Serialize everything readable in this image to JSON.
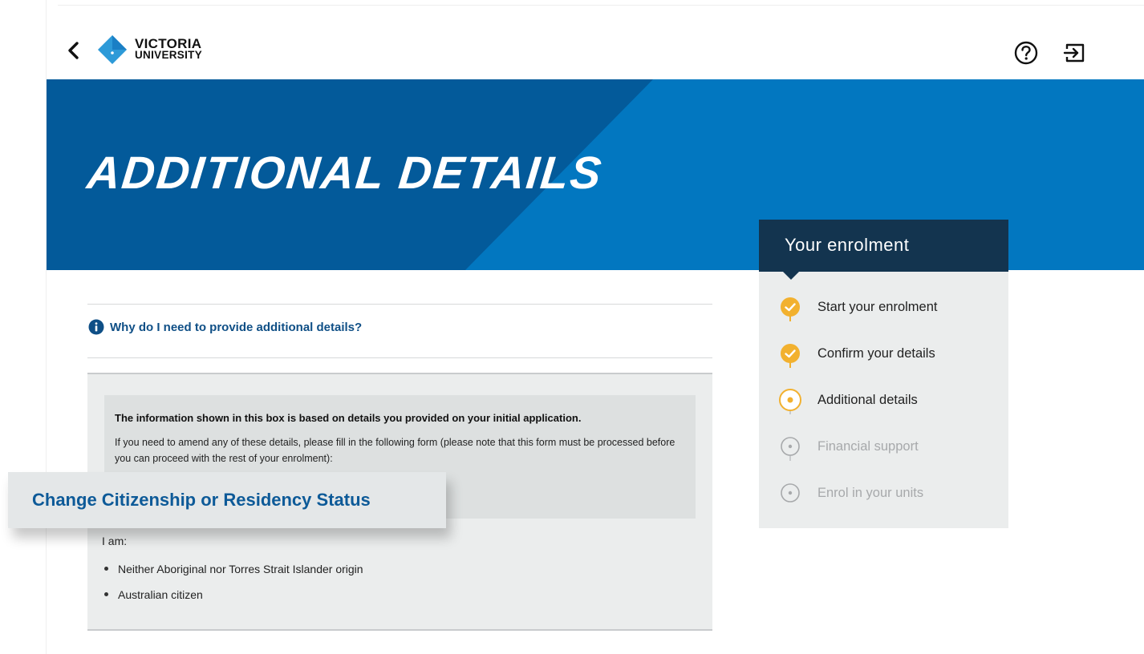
{
  "header": {
    "logo": {
      "line1": "VICTORIA",
      "line2": "UNIVERSITY"
    },
    "icons": {
      "back": "chevron-left-icon",
      "help": "question-circle-icon",
      "logout": "logout-icon"
    }
  },
  "banner": {
    "title": "ADDITIONAL DETAILS"
  },
  "sidebar": {
    "heading": "Your enrolment",
    "steps": [
      {
        "label": "Start your enrolment",
        "status": "complete"
      },
      {
        "label": "Confirm your details",
        "status": "complete"
      },
      {
        "label": "Additional details",
        "status": "current"
      },
      {
        "label": "Financial support",
        "status": "pending"
      },
      {
        "label": "Enrol in your units",
        "status": "pending"
      }
    ]
  },
  "main": {
    "why_link": "Why do I need to provide additional details?",
    "notice": {
      "title": "The information shown in this box is based on details you provided on your initial application.",
      "body": "If you need to amend any of these details, please fill in the following form (please note that this form must be processed before you can proceed with the rest of your enrolment):"
    },
    "change_button": "Change Citizenship or Residency Status",
    "i_am_label": "I am:",
    "details": [
      "Neither Aboriginal nor Torres Strait Islander origin",
      "Australian citizen"
    ]
  },
  "colors": {
    "banner_dark": "#035a9a",
    "banner_light": "#0277c0",
    "sidebar_head": "#13344f",
    "step_accent": "#f2b12f",
    "link": "#0f4f86"
  }
}
